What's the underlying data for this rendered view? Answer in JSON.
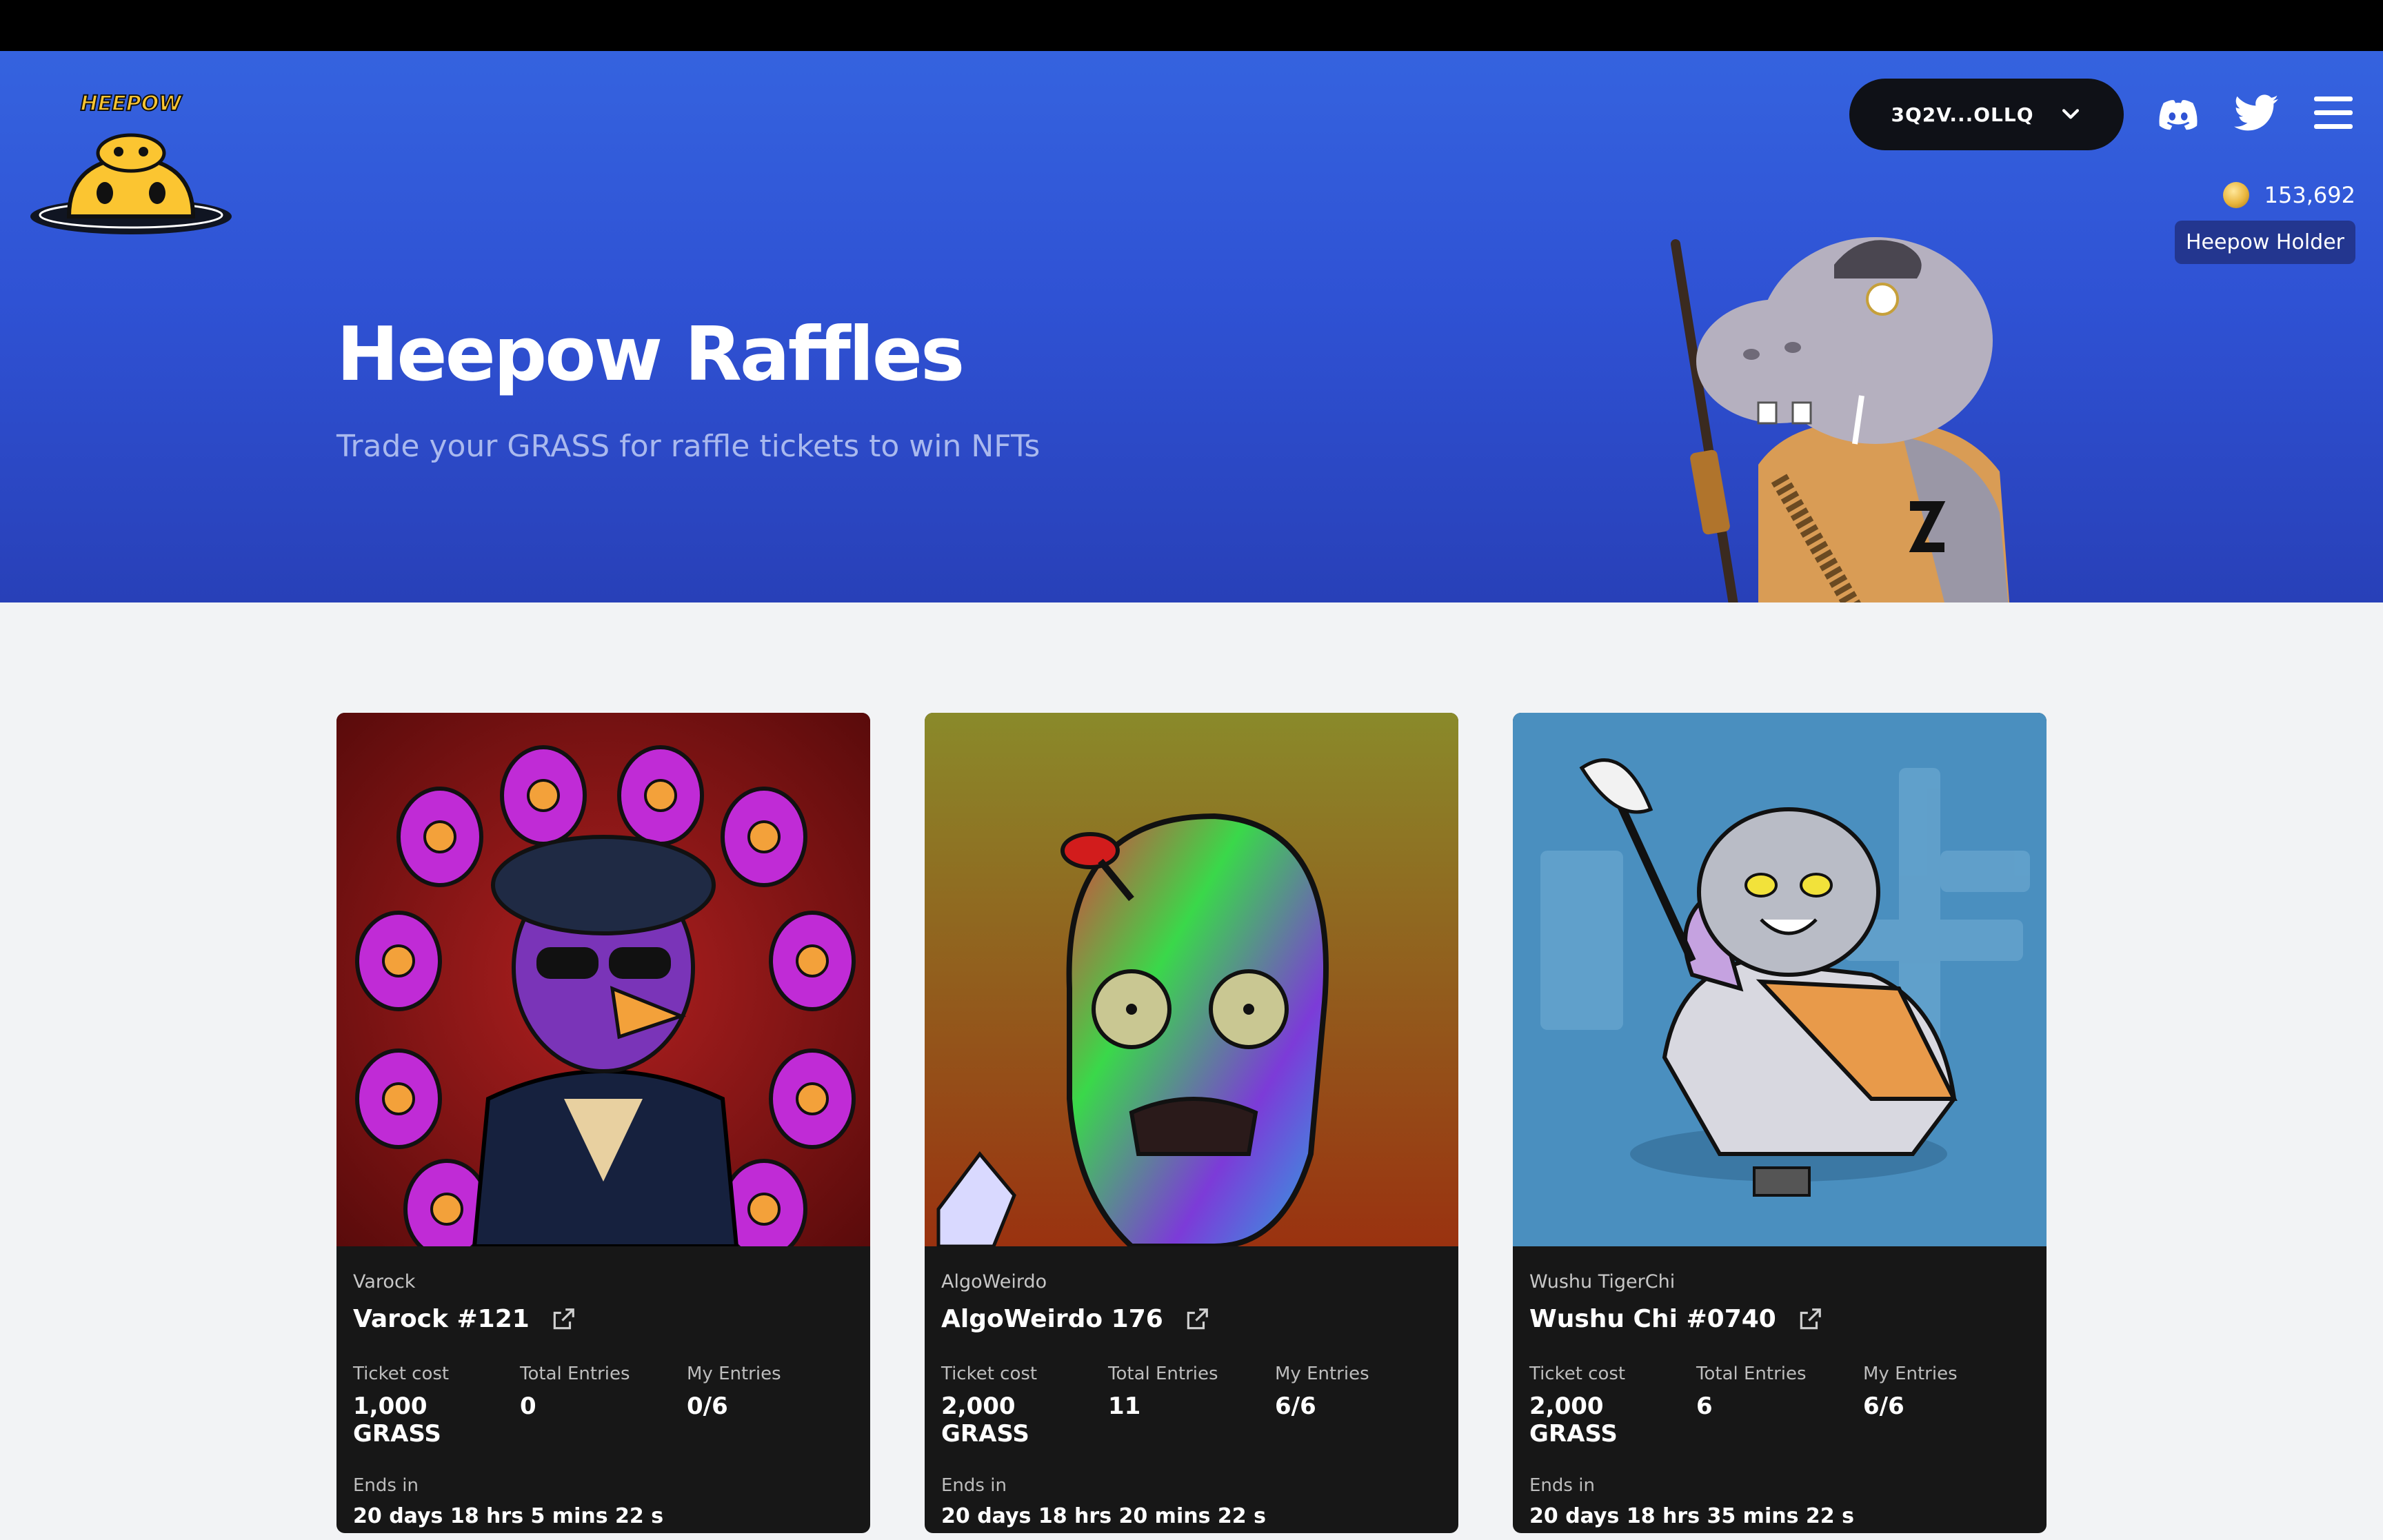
{
  "header": {
    "logo_text": "HEEPOW",
    "title": "Heepow Raffles",
    "subtitle": "Trade your GRASS for raffle tickets to win NFTs",
    "wallet_label": "3Q2V...OLLQ",
    "balance": "153,692",
    "badge": "Heepow Holder",
    "icons": [
      "discord-icon",
      "twitter-icon",
      "menu-icon",
      "chevron-down-icon",
      "coin-icon"
    ]
  },
  "cards": [
    {
      "collection": "Varock",
      "name": "Varock #121",
      "ticket_cost_label": "Ticket cost",
      "ticket_cost": "1,000 GRASS",
      "total_entries_label": "Total Entries",
      "total_entries": "0",
      "my_entries_label": "My Entries",
      "my_entries": "0/6",
      "ends_label": "Ends in",
      "ends_in": "20 days 18 hrs 5 mins 22 s"
    },
    {
      "collection": "AlgoWeirdo",
      "name": "AlgoWeirdo 176",
      "ticket_cost_label": "Ticket cost",
      "ticket_cost": "2,000 GRASS",
      "total_entries_label": "Total Entries",
      "total_entries": "11",
      "my_entries_label": "My Entries",
      "my_entries": "6/6",
      "ends_label": "Ends in",
      "ends_in": "20 days 18 hrs 20 mins 22 s"
    },
    {
      "collection": "Wushu TigerChi",
      "name": "Wushu Chi #0740",
      "ticket_cost_label": "Ticket cost",
      "ticket_cost": "2,000 GRASS",
      "total_entries_label": "Total Entries",
      "total_entries": "6",
      "my_entries_label": "My Entries",
      "my_entries": "6/6",
      "ends_label": "Ends in",
      "ends_in": "20 days 18 hrs 35 mins 22 s"
    }
  ],
  "colors": {
    "hero_top": "#3563df",
    "hero_bottom": "#2840b8",
    "card_bg": "#171717",
    "page_bg": "#f2f3f5"
  }
}
